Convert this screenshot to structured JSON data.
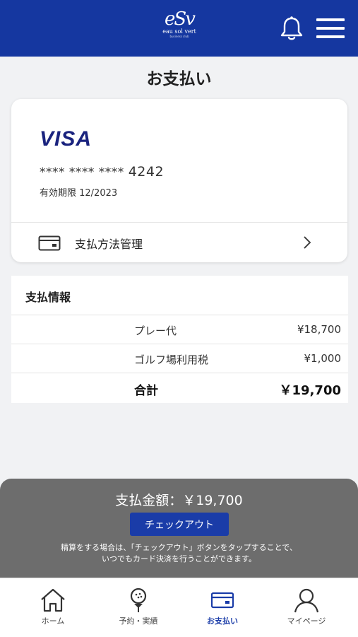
{
  "header": {
    "logo_mark": "eSv",
    "logo_text": "eau sol vert",
    "logo_sub": "business club",
    "bell_icon": "bell-icon",
    "menu_icon": "hamburger-menu-icon",
    "color": "#1537a0"
  },
  "page": {
    "title": "お支払い"
  },
  "card": {
    "brand": "VISA",
    "masked_number": "**** **** ****",
    "last4": "4242",
    "expiry": "有効期限 12/2023",
    "payment_method_label": "支払方法管理",
    "payment_method_icon": "card-icon",
    "chevron_icon": "chevron-right-icon",
    "brand_color": "#1a237e"
  },
  "payment_info": {
    "title": "支払情報",
    "rows": [
      {
        "label": "プレー代",
        "amount": "¥18,700"
      },
      {
        "label": "ゴルフ場利用税",
        "amount": "¥1,000"
      }
    ],
    "total": {
      "label": "合計",
      "amount": "￥19,700"
    }
  },
  "checkout": {
    "total_text": "支払金額：￥19,700",
    "button_label": "チェックアウト",
    "note_line1": "精算をする場合は、「チェックアウト」ボタンをタップすることで、",
    "note_line2": "いつでもカード決済を行うことができます。",
    "button_color": "#1a3ca8",
    "panel_color": "#6d6d6d"
  },
  "nav": {
    "items": [
      {
        "label": "ホーム",
        "icon": "home-icon",
        "active": false
      },
      {
        "label": "予約・実績",
        "icon": "golf-ball-icon",
        "active": false
      },
      {
        "label": "お支払い",
        "icon": "card-icon",
        "active": true
      },
      {
        "label": "マイページ",
        "icon": "user-icon",
        "active": false
      }
    ]
  }
}
